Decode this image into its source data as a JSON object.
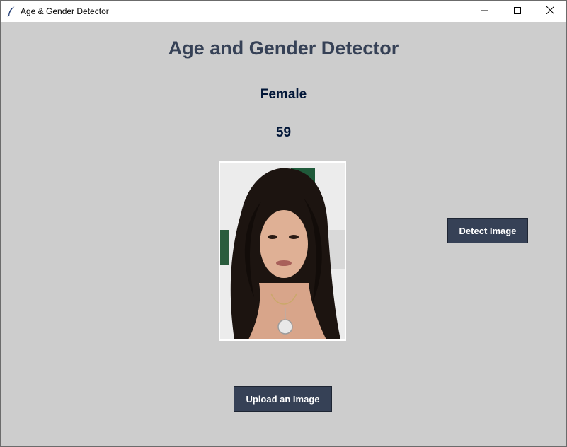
{
  "window": {
    "title": "Age & Gender Detector",
    "icon": "feather-icon",
    "controls": [
      "minimize-icon",
      "maximize-icon",
      "close-icon"
    ]
  },
  "main": {
    "heading": "Age and Gender Detector",
    "gender_result": "Female",
    "age_result": "59",
    "photo_icon": "portrait-photo"
  },
  "buttons": {
    "detect_label": "Detect Image",
    "upload_label": "Upload an Image"
  },
  "colors": {
    "background": "#cdcdcd",
    "heading": "#364156",
    "result_text": "#011638",
    "button_bg": "#364156",
    "button_text": "#ffffff"
  }
}
